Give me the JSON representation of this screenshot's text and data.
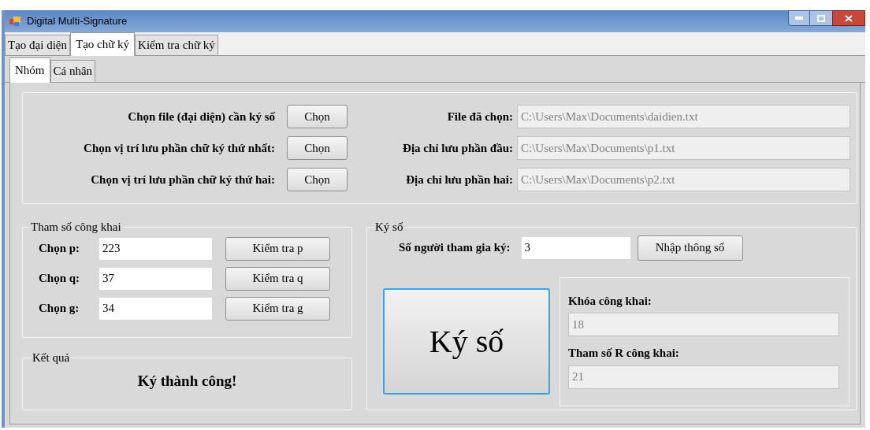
{
  "window": {
    "title": "Digital Multi-Signature"
  },
  "tabs": [
    {
      "label": "Tạo đại diện",
      "selected": false
    },
    {
      "label": "Tạo chữ ký",
      "selected": true
    },
    {
      "label": "Kiểm tra chữ ký",
      "selected": false
    }
  ],
  "subtabs": [
    {
      "label": "Nhóm",
      "selected": true
    },
    {
      "label": "Cá nhân",
      "selected": false
    }
  ],
  "files": [
    {
      "label": "Chọn file (đại diện) cần ký số",
      "button": "Chọn",
      "field_label": "File đã chọn:",
      "value": "C:\\Users\\Max\\Documents\\daidien.txt"
    },
    {
      "label": "Chọn vị trí lưu phần chữ ký thứ nhất:",
      "button": "Chọn",
      "field_label": "Địa chỉ lưu phần đầu:",
      "value": "C:\\Users\\Max\\Documents\\p1.txt"
    },
    {
      "label": "Chọn vị trí lưu phần chữ ký thứ hai:",
      "button": "Chọn",
      "field_label": "Địa chỉ lưu phần hai:",
      "value": "C:\\Users\\Max\\Documents\\p2.txt"
    }
  ],
  "public_params": {
    "title": "Tham số công khai",
    "rows": [
      {
        "label": "Chọn p:",
        "value": "223",
        "button": "Kiểm tra p"
      },
      {
        "label": "Chọn q:",
        "value": "37",
        "button": "Kiểm tra q"
      },
      {
        "label": "Chọn g:",
        "value": "34",
        "button": "Kiểm tra g"
      }
    ]
  },
  "result": {
    "title": "Kết quả",
    "message": "Ký thành công!"
  },
  "signing": {
    "title": "Ký số",
    "participants_label": "Số người tham gia ký:",
    "participants_value": "3",
    "enter_button": "Nhập thông số",
    "sign_button": "Ký số",
    "outputs": [
      {
        "label": "Khóa công khai:",
        "value": "18"
      },
      {
        "label": "Tham số R công khai:",
        "value": "21"
      }
    ]
  }
}
